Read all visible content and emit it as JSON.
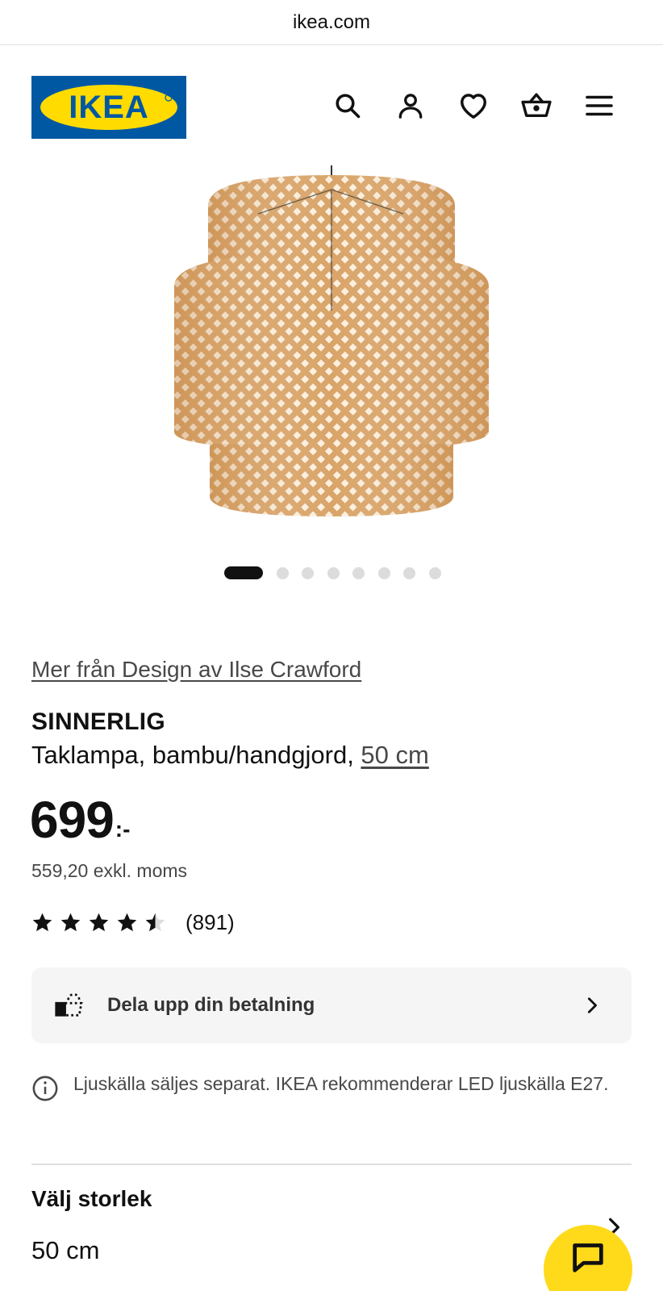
{
  "browser": {
    "url": "ikea.com"
  },
  "header": {
    "logo_text": "IKEA",
    "brand_colors": {
      "blue": "#0058A3",
      "yellow": "#FFDB00"
    },
    "icons": [
      "search-icon",
      "profile-icon",
      "heart-icon",
      "basket-icon",
      "menu-icon"
    ]
  },
  "gallery": {
    "image_count": 8,
    "active_index": 0
  },
  "product": {
    "designer_link": "Mer från Design av Ilse Crawford",
    "name": "SINNERLIG",
    "description_prefix": "Taklampa, bambu/handgjord, ",
    "size_link": "50 cm",
    "price": "699",
    "price_suffix": ":-",
    "price_excl_vat": "559,20 exkl. moms",
    "rating": {
      "stars": 4.5,
      "max": 5,
      "count": "(891)"
    }
  },
  "payment": {
    "label": "Dela upp din betalning"
  },
  "info": {
    "text": "Ljuskälla säljes separat. IKEA rekommenderar LED ljuskälla E27."
  },
  "size_selector": {
    "title": "Välj storlek",
    "value": "50 cm"
  },
  "chat": {
    "icon": "chat-icon",
    "color": "#FFDA1A"
  }
}
